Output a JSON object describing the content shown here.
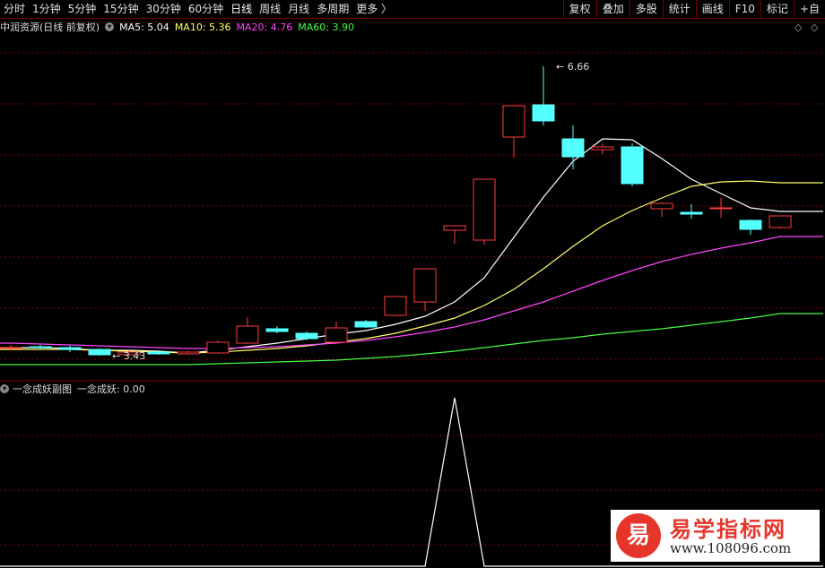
{
  "toolbar": {
    "periods": [
      {
        "label": "分时",
        "active": false
      },
      {
        "label": "1分钟",
        "active": false
      },
      {
        "label": "5分钟",
        "active": false
      },
      {
        "label": "15分钟",
        "active": false
      },
      {
        "label": "30分钟",
        "active": false
      },
      {
        "label": "60分钟",
        "active": false
      },
      {
        "label": "日线",
        "active": true
      },
      {
        "label": "周线",
        "active": false
      },
      {
        "label": "月线",
        "active": false
      },
      {
        "label": "多周期",
        "active": false
      },
      {
        "label": "更多 〉",
        "active": false
      }
    ],
    "right_buttons": [
      "复权",
      "叠加",
      "多股",
      "统计",
      "画线",
      "F10",
      "标记",
      "+自"
    ]
  },
  "main_panel": {
    "title": "中润资源(日线 前复权)",
    "ma_labels": [
      {
        "text": "MA5: 5.04",
        "color": "#ffffff"
      },
      {
        "text": "MA10: 5.36",
        "color": "#ffff66"
      },
      {
        "text": "MA20: 4.76",
        "color": "#ff44ff"
      },
      {
        "text": "MA60: 3.90",
        "color": "#44ff44"
      }
    ]
  },
  "sub_panel": {
    "title": "一念成妖副图",
    "value_label": "一念成妖: 0.00"
  },
  "watermark": {
    "badge": "易",
    "title": "易学指标网",
    "url": "www.108096.com"
  },
  "colors": {
    "up": "#ff3b3b",
    "down": "#54ffff",
    "grid": "#7a0000",
    "ma5": "#ffffff",
    "ma10": "#ffff66",
    "ma20": "#ff44ff",
    "ma60": "#44ff44"
  },
  "chart_data": [
    {
      "type": "candlestick",
      "title": "中润资源(日线 前复权)",
      "ylim": [
        3.2,
        7.0
      ],
      "annotations": [
        {
          "text": "6.66",
          "at": "max-high",
          "value": 6.66
        },
        {
          "text": "3.43",
          "at": "min-low",
          "value": 3.43
        }
      ],
      "candles": [
        {
          "open": 3.52,
          "close": 3.52,
          "high": 3.55,
          "low": 3.49
        },
        {
          "open": 3.53,
          "close": 3.52,
          "high": 3.55,
          "low": 3.5
        },
        {
          "open": 3.52,
          "close": 3.5,
          "high": 3.54,
          "low": 3.47
        },
        {
          "open": 3.5,
          "close": 3.44,
          "high": 3.51,
          "low": 3.43
        },
        {
          "open": 3.44,
          "close": 3.47,
          "high": 3.49,
          "low": 3.43
        },
        {
          "open": 3.47,
          "close": 3.45,
          "high": 3.48,
          "low": 3.44
        },
        {
          "open": 3.45,
          "close": 3.47,
          "high": 3.48,
          "low": 3.44
        },
        {
          "open": 3.46,
          "close": 3.58,
          "high": 3.6,
          "low": 3.46
        },
        {
          "open": 3.57,
          "close": 3.76,
          "high": 3.86,
          "low": 3.56
        },
        {
          "open": 3.73,
          "close": 3.7,
          "high": 3.76,
          "low": 3.68
        },
        {
          "open": 3.68,
          "close": 3.62,
          "high": 3.7,
          "low": 3.6
        },
        {
          "open": 3.58,
          "close": 3.74,
          "high": 3.81,
          "low": 3.57
        },
        {
          "open": 3.81,
          "close": 3.75,
          "high": 3.83,
          "low": 3.74
        },
        {
          "open": 3.88,
          "close": 4.09,
          "high": 4.09,
          "low": 3.88
        },
        {
          "open": 4.03,
          "close": 4.4,
          "high": 4.4,
          "low": 3.93
        },
        {
          "open": 4.83,
          "close": 4.88,
          "high": 4.88,
          "low": 4.68
        },
        {
          "open": 4.72,
          "close": 5.4,
          "high": 5.4,
          "low": 4.67
        },
        {
          "open": 5.87,
          "close": 6.22,
          "high": 6.22,
          "low": 5.64
        },
        {
          "open": 6.23,
          "close": 6.05,
          "high": 6.66,
          "low": 6.0
        },
        {
          "open": 5.85,
          "close": 5.65,
          "high": 6.0,
          "low": 5.51
        },
        {
          "open": 5.73,
          "close": 5.76,
          "high": 5.8,
          "low": 5.68
        },
        {
          "open": 5.76,
          "close": 5.35,
          "high": 5.8,
          "low": 5.32
        },
        {
          "open": 5.07,
          "close": 5.13,
          "high": 5.14,
          "low": 4.98
        },
        {
          "open": 5.03,
          "close": 5.01,
          "high": 5.12,
          "low": 4.96
        },
        {
          "open": 5.08,
          "close": 5.08,
          "high": 5.19,
          "low": 4.97
        },
        {
          "open": 4.94,
          "close": 4.84,
          "high": 4.95,
          "low": 4.78
        },
        {
          "open": 4.86,
          "close": 4.99,
          "high": 4.99,
          "low": 4.85
        }
      ],
      "series": [
        {
          "name": "MA5",
          "values": [
            3.52,
            3.52,
            3.51,
            3.49,
            3.49,
            3.48,
            3.46,
            3.49,
            3.53,
            3.57,
            3.62,
            3.67,
            3.71,
            3.78,
            3.87,
            4.03,
            4.3,
            4.75,
            5.2,
            5.6,
            5.85,
            5.84,
            5.63,
            5.4,
            5.24,
            5.08,
            5.04
          ]
        },
        {
          "name": "MA10",
          "values": [
            3.5,
            3.5,
            3.5,
            3.49,
            3.48,
            3.47,
            3.46,
            3.47,
            3.49,
            3.51,
            3.54,
            3.58,
            3.62,
            3.68,
            3.76,
            3.85,
            3.99,
            4.17,
            4.4,
            4.65,
            4.88,
            5.05,
            5.19,
            5.32,
            5.37,
            5.38,
            5.36
          ]
        },
        {
          "name": "MA20",
          "values": [
            3.57,
            3.56,
            3.55,
            3.54,
            3.53,
            3.52,
            3.51,
            3.51,
            3.52,
            3.53,
            3.55,
            3.57,
            3.6,
            3.64,
            3.69,
            3.75,
            3.83,
            3.93,
            4.03,
            4.15,
            4.27,
            4.38,
            4.48,
            4.56,
            4.63,
            4.69,
            4.76
          ]
        },
        {
          "name": "MA60",
          "values": [
            3.33,
            3.33,
            3.33,
            3.33,
            3.33,
            3.33,
            3.33,
            3.34,
            3.35,
            3.36,
            3.37,
            3.38,
            3.4,
            3.42,
            3.45,
            3.48,
            3.52,
            3.56,
            3.6,
            3.63,
            3.67,
            3.7,
            3.73,
            3.77,
            3.81,
            3.85,
            3.9
          ]
        }
      ]
    },
    {
      "type": "line",
      "title": "一念成妖副图",
      "ylim": [
        0,
        1
      ],
      "series": [
        {
          "name": "一念成妖",
          "values": [
            0,
            0,
            0,
            0,
            0,
            0,
            0,
            0,
            0,
            0,
            0,
            0,
            0,
            0,
            0,
            1,
            0,
            0,
            0,
            0,
            0,
            0,
            0,
            0,
            0,
            0,
            0
          ]
        }
      ]
    }
  ]
}
